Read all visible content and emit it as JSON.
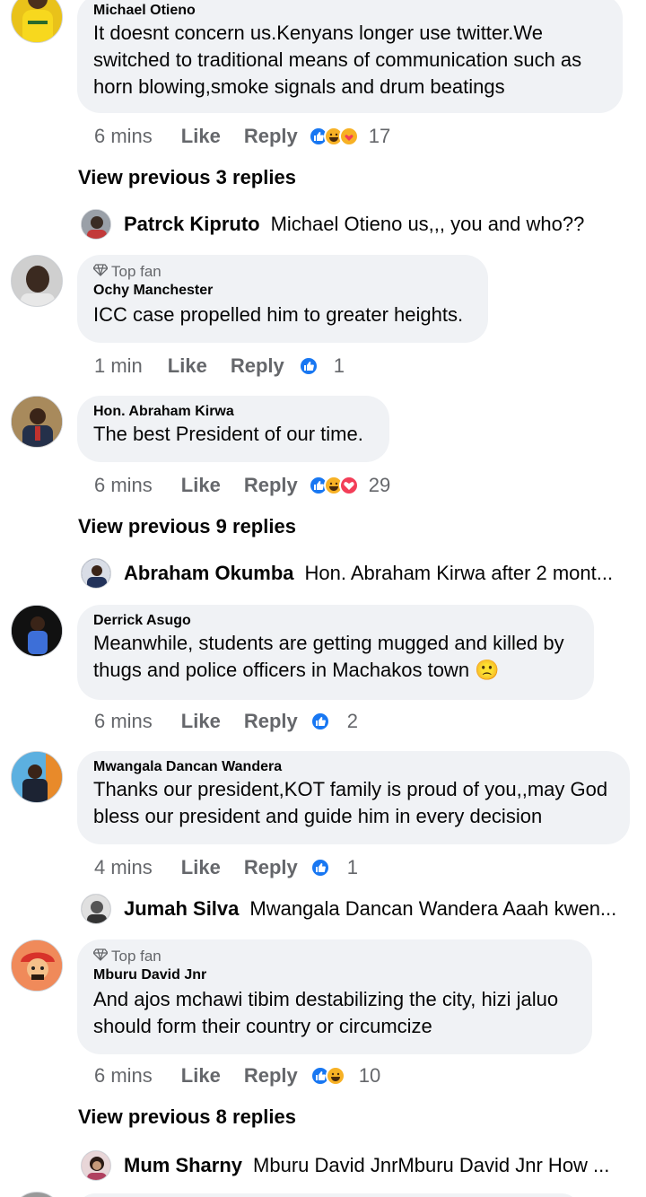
{
  "colors": {
    "bubble": "#f0f2f5",
    "meta_text": "#65676b",
    "like_blue": "#1877f2",
    "love_red": "#f33e58",
    "haha_yellow": "#f7b125"
  },
  "comments": [
    {
      "author": "Michael Otieno",
      "lines": [
        "It doesnt concern us.Kenyans longer use twitter.We",
        "switched to traditional means of communication such as",
        "horn blowing,smoke signals and drum beatings"
      ],
      "time": "6 mins",
      "like": "Like",
      "reply": "Reply",
      "reactions": [
        "like-reaction",
        "haha-reaction",
        "care-reaction"
      ],
      "count": "17"
    },
    {
      "badge": "Top fan",
      "author": "Ochy Manchester",
      "lines": [
        "ICC case propelled him to greater heights."
      ],
      "time": "1 min",
      "like": "Like",
      "reply": "Reply",
      "reactions": [
        "like-reaction"
      ],
      "count": "1"
    },
    {
      "author": "Hon. Abraham Kirwa",
      "lines": [
        "The best President of our time."
      ],
      "time": "6 mins",
      "like": "Like",
      "reply": "Reply",
      "reactions": [
        "like-reaction",
        "haha-reaction",
        "love-reaction"
      ],
      "count": "29"
    },
    {
      "author": "Derrick Asugo",
      "lines": [
        "Meanwhile, students are getting mugged and killed by",
        "thugs and police officers in Machakos town 🙁"
      ],
      "time": "6 mins",
      "like": "Like",
      "reply": "Reply",
      "reactions": [
        "like-reaction"
      ],
      "count": "2"
    },
    {
      "author": "Mwangala Dancan Wandera",
      "lines": [
        "Thanks our president,KOT family is proud of you,,may God",
        "bless our president and guide him in every decision"
      ],
      "time": "4 mins",
      "like": "Like",
      "reply": "Reply",
      "reactions": [
        "like-reaction"
      ],
      "count": "1"
    },
    {
      "badge": "Top fan",
      "author": "Mburu David Jnr",
      "lines": [
        "And ajos mchawi tibim destabilizing the city, hizi jaluo",
        "should form their country or circumcize"
      ],
      "time": "6 mins",
      "like": "Like",
      "reply": "Reply",
      "reactions": [
        "like-reaction",
        "haha-reaction"
      ],
      "count": "10"
    }
  ],
  "view_previous": [
    "View previous 3 replies",
    "View previous 9 replies",
    "View previous 8 replies"
  ],
  "replies": [
    {
      "name": "Patrck Kipruto",
      "text": "Michael Otieno us,,, you and who??"
    },
    {
      "name": "Abraham Okumba",
      "text": "Hon. Abraham Kirwa after 2 mont..."
    },
    {
      "name": "Jumah Silva",
      "text": "Mwangala Dancan Wandera Aaah kwen..."
    },
    {
      "name": "Mum Sharny",
      "text": "Mburu David JnrMburu David Jnr How ..."
    }
  ]
}
